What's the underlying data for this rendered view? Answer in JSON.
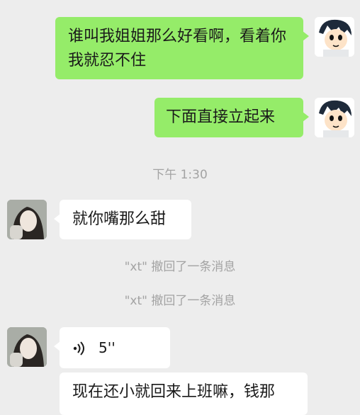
{
  "messages": [
    {
      "side": "me",
      "text": "谁叫我姐姐那么好看啊，看着你 我就忍不住"
    },
    {
      "side": "me",
      "text": "下面直接立起来"
    },
    {
      "side": "her",
      "text": "就你嘴那么甜"
    },
    {
      "side": "her",
      "type": "voice",
      "duration": "5''"
    },
    {
      "side": "her",
      "text": "现在还小就回来上班嘛，钱那"
    }
  ],
  "timestamp": "下午 1:30",
  "recall_notices": [
    "\"xt\" 撤回了一条消息",
    "\"xt\" 撤回了一条消息"
  ],
  "colors": {
    "me_bubble": "#95ec69",
    "her_bubble": "#ffffff",
    "background": "#ededed"
  }
}
